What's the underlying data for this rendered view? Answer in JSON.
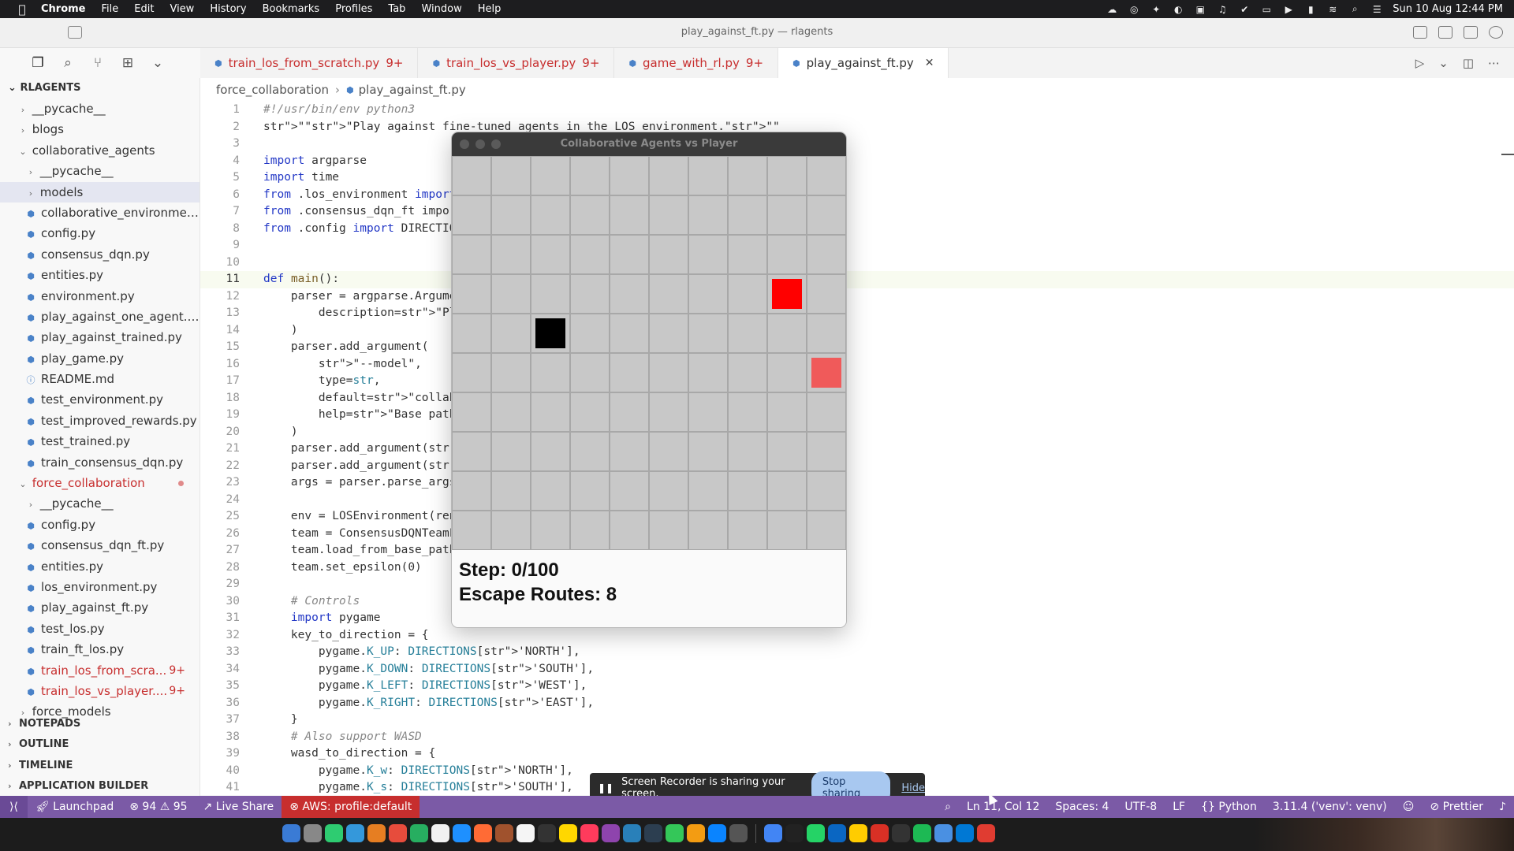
{
  "menubar": {
    "app": "Chrome",
    "items": [
      "File",
      "Edit",
      "View",
      "History",
      "Bookmarks",
      "Profiles",
      "Tab",
      "Window",
      "Help"
    ],
    "clock": "Sun 10 Aug  12:44 PM"
  },
  "window": {
    "title": "play_against_ft.py — rlagents"
  },
  "sidebar": {
    "root": "RLAGENTS",
    "rows": [
      {
        "label": "__pycache__",
        "indent": 1,
        "type": "folder",
        "open": false
      },
      {
        "label": "blogs",
        "indent": 1,
        "type": "folder",
        "open": false
      },
      {
        "label": "collaborative_agents",
        "indent": 1,
        "type": "folder",
        "open": true
      },
      {
        "label": "__pycache__",
        "indent": 2,
        "type": "folder",
        "open": false
      },
      {
        "label": "models",
        "indent": 2,
        "type": "folder",
        "open": false,
        "selected": true
      },
      {
        "label": "collaborative_environmen...",
        "indent": 2,
        "type": "py"
      },
      {
        "label": "config.py",
        "indent": 2,
        "type": "py"
      },
      {
        "label": "consensus_dqn.py",
        "indent": 2,
        "type": "py"
      },
      {
        "label": "entities.py",
        "indent": 2,
        "type": "py"
      },
      {
        "label": "environment.py",
        "indent": 2,
        "type": "py"
      },
      {
        "label": "play_against_one_agent.py",
        "indent": 2,
        "type": "py"
      },
      {
        "label": "play_against_trained.py",
        "indent": 2,
        "type": "py"
      },
      {
        "label": "play_game.py",
        "indent": 2,
        "type": "py"
      },
      {
        "label": "README.md",
        "indent": 2,
        "type": "md"
      },
      {
        "label": "test_environment.py",
        "indent": 2,
        "type": "py"
      },
      {
        "label": "test_improved_rewards.py",
        "indent": 2,
        "type": "py"
      },
      {
        "label": "test_trained.py",
        "indent": 2,
        "type": "py"
      },
      {
        "label": "train_consensus_dqn.py",
        "indent": 2,
        "type": "py"
      },
      {
        "label": "force_collaboration",
        "indent": 1,
        "type": "folder",
        "open": true,
        "red": true,
        "dot": true
      },
      {
        "label": "__pycache__",
        "indent": 2,
        "type": "folder",
        "open": false
      },
      {
        "label": "config.py",
        "indent": 2,
        "type": "py"
      },
      {
        "label": "consensus_dqn_ft.py",
        "indent": 2,
        "type": "py"
      },
      {
        "label": "entities.py",
        "indent": 2,
        "type": "py"
      },
      {
        "label": "los_environment.py",
        "indent": 2,
        "type": "py"
      },
      {
        "label": "play_against_ft.py",
        "indent": 2,
        "type": "py"
      },
      {
        "label": "test_los.py",
        "indent": 2,
        "type": "py"
      },
      {
        "label": "train_ft_los.py",
        "indent": 2,
        "type": "py"
      },
      {
        "label": "train_los_from_scra...",
        "indent": 2,
        "type": "py",
        "red": true,
        "badge": "9+"
      },
      {
        "label": "train_los_vs_player....",
        "indent": 2,
        "type": "py",
        "red": true,
        "badge": "9+"
      },
      {
        "label": "force_models",
        "indent": 1,
        "type": "folder",
        "open": false
      }
    ],
    "sections": [
      "NOTEPADS",
      "OUTLINE",
      "TIMELINE",
      "APPLICATION BUILDER"
    ]
  },
  "tabs": [
    {
      "label": "train_los_from_scratch.py",
      "badge": "9+",
      "modified": true
    },
    {
      "label": "train_los_vs_player.py",
      "badge": "9+",
      "modified": true
    },
    {
      "label": "game_with_rl.py",
      "badge": "9+",
      "modified": true
    },
    {
      "label": "play_against_ft.py",
      "badge": "",
      "modified": false,
      "active": true
    }
  ],
  "breadcrumb": [
    "force_collaboration",
    "play_against_ft.py"
  ],
  "code": [
    "#!/usr/bin/env python3",
    "\"\"\"Play against fine-tuned agents in the LOS environment.\"\"\"",
    "",
    "import argparse",
    "import time",
    "from .los_environment import",
    "from .consensus_dqn_ft impo",
    "from .config import DIRECTIO",
    "",
    "",
    "def main():",
    "    parser = argparse.Argume",
    "        description=\"Play vs",
    "    )",
    "    parser.add_argument(",
    "        \"--model\",",
    "        type=str,",
    "        default=\"collaborati",
    "        help=\"Base path to t",
    "    )",
    "    parser.add_argument(\"--r",
    "    parser.add_argument(\"--r",
    "    args = parser.parse_args",
    "",
    "    env = LOSEnvironment(ren",
    "    team = ConsensusDQNTeamF",
    "    team.load_from_base_path",
    "    team.set_epsilon(0)",
    "",
    "    # Controls",
    "    import pygame",
    "    key_to_direction = {",
    "        pygame.K_UP: DIRECTIONS['NORTH'],",
    "        pygame.K_DOWN: DIRECTIONS['SOUTH'],",
    "        pygame.K_LEFT: DIRECTIONS['WEST'],",
    "        pygame.K_RIGHT: DIRECTIONS['EAST'],",
    "    }",
    "    # Also support WASD",
    "    wasd_to_direction = {",
    "        pygame.K_w: DIRECTIONS['NORTH'],",
    "        pygame.K_s: DIRECTIONS['SOUTH'],"
  ],
  "current_line": 11,
  "game": {
    "title": "Collaborative Agents vs Player",
    "grid_size": 10,
    "pieces": [
      {
        "row": 3,
        "col": 8,
        "color": "#ff0000"
      },
      {
        "row": 4,
        "col": 2,
        "color": "#000000"
      },
      {
        "row": 5,
        "col": 9,
        "color": "#f05a5a"
      }
    ],
    "step_text": "Step: 0/100",
    "escape_text": "Escape Routes: 8"
  },
  "share_bar": {
    "message": "Screen Recorder is sharing your screen.",
    "stop_label": "Stop sharing",
    "hide_label": "Hide"
  },
  "statusbar": {
    "launchpad": "Launchpad",
    "errors": "94",
    "warnings": "95",
    "live_share": "Live Share",
    "aws": "AWS: profile:default",
    "position": "Ln 11, Col 12",
    "spaces": "Spaces: 4",
    "encoding": "UTF-8",
    "eol": "LF",
    "language": "Python",
    "interpreter": "3.11.4 ('venv': venv)",
    "prettier": "Prettier"
  },
  "colors": {
    "statusbar": "#7b5aa6",
    "aws": "#c72e2e",
    "modified": "#c72e2e",
    "keyword": "#2338c6",
    "string": "#a31515"
  }
}
